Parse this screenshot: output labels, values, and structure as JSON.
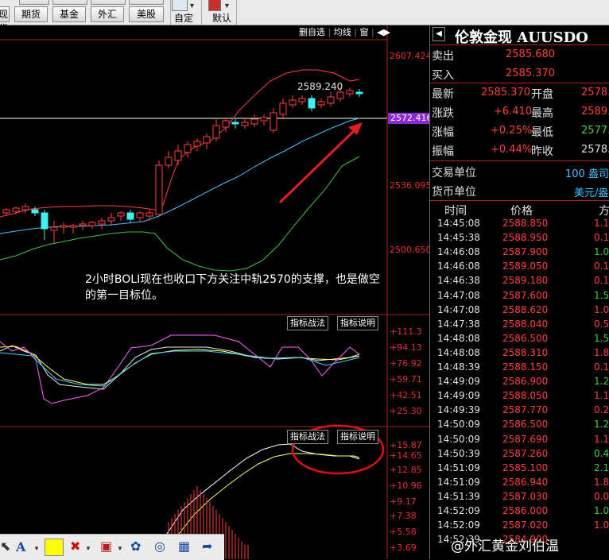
{
  "toolbar": {
    "buttons": [
      "期货",
      "基金",
      "外汇",
      "美股"
    ],
    "partial_button": "现货",
    "tools": [
      {
        "label": "自定"
      },
      {
        "label": "默认"
      }
    ]
  },
  "chart": {
    "top_buttons": [
      "删自选",
      "均线",
      "窗"
    ],
    "top_play_icon": "play-icon",
    "price_axis": [
      "2607.424",
      "2536.095",
      "2500.650"
    ],
    "current_price_tag": "2572.416",
    "high_label": "2589.240",
    "annotation": "2小时BOLI现在也收口下方关注中轨2570的支撑，也是做空的第一目标位。",
    "indicator1": {
      "buttons": [
        "指标战法",
        "指标说明"
      ],
      "axis": [
        "+111.3",
        "+94.13",
        "+76.92",
        "+59.71",
        "+42.51",
        "+25.30"
      ]
    },
    "indicator2": {
      "buttons": [
        "指标战法",
        "指标说明"
      ],
      "axis": [
        "+15.87",
        "+14.65",
        "+12.85",
        "+10.96",
        "+9.17",
        "+7.38",
        "+5.58",
        "+3.69"
      ]
    },
    "colors": {
      "upper_band": "#ff4040",
      "middle_band": "#40c0ff",
      "lower_band": "#40c040",
      "current_line": "#ffffff"
    }
  },
  "panel": {
    "title": "伦敦金现 AUUSDO",
    "sell_label": "卖出",
    "sell_value": "2585.680",
    "buy_label": "买入",
    "buy_value": "2585.370",
    "stats": [
      {
        "label": "最新",
        "value": "2585.370",
        "label2": "开盘",
        "value2": "2578."
      },
      {
        "label": "涨跌",
        "value": "+6.410",
        "label2": "最高",
        "value2": "2589."
      },
      {
        "label": "涨幅",
        "value": "+0.25%",
        "label2": "最低",
        "value2": "2577."
      },
      {
        "label": "振幅",
        "value": "+0.44%",
        "label2": "昨收",
        "value2": "2578."
      }
    ],
    "trade_unit_label": "交易单位",
    "trade_unit_value": "100 盎司",
    "currency_label": "货币单位",
    "currency_value": "美元/盎",
    "tick_headers": [
      "时间",
      "价格",
      "方"
    ],
    "ticks": [
      {
        "time": "14:45:08",
        "price": "2588.850",
        "vol": "1.1"
      },
      {
        "time": "14:45:38",
        "price": "2588.950",
        "vol": "0.1"
      },
      {
        "time": "14:46:08",
        "price": "2587.900",
        "vol": "1.0"
      },
      {
        "time": "14:46:08",
        "price": "2589.050",
        "vol": "0.1"
      },
      {
        "time": "14:46:38",
        "price": "2589.180",
        "vol": "0.1"
      },
      {
        "time": "14:47:08",
        "price": "2587.600",
        "vol": "1.5"
      },
      {
        "time": "14:47:08",
        "price": "2588.620",
        "vol": "1.0"
      },
      {
        "time": "14:47:38",
        "price": "2588.040",
        "vol": "0.5"
      },
      {
        "time": "14:48:08",
        "price": "2586.500",
        "vol": "1.5"
      },
      {
        "time": "14:48:08",
        "price": "2588.310",
        "vol": "1.8"
      },
      {
        "time": "14:48:39",
        "price": "2588.150",
        "vol": "0.1"
      },
      {
        "time": "14:49:09",
        "price": "2586.900",
        "vol": "1.2"
      },
      {
        "time": "14:49:09",
        "price": "2588.050",
        "vol": "1.1"
      },
      {
        "time": "14:49:39",
        "price": "2587.770",
        "vol": "0.2"
      },
      {
        "time": "14:50:09",
        "price": "2586.500",
        "vol": "1.2"
      },
      {
        "time": "14:50:09",
        "price": "2587.690",
        "vol": "1.1"
      },
      {
        "time": "14:50:39",
        "price": "2587.260",
        "vol": "0.4"
      },
      {
        "time": "14:51:09",
        "price": "2585.100",
        "vol": "2.1"
      },
      {
        "time": "14:51:09",
        "price": "2586.940",
        "vol": "1.8"
      },
      {
        "time": "14:51:39",
        "price": "2587.030",
        "vol": "0.0"
      },
      {
        "time": "14:52:09",
        "price": "2586.000",
        "vol": "1.0"
      },
      {
        "time": "14:52:09",
        "price": "2587.020",
        "vol": "1.0"
      },
      {
        "time": "14:52:39",
        "price": "2584.900",
        "vol": ""
      }
    ]
  },
  "watermark": "@外汇黄金刘伯温"
}
